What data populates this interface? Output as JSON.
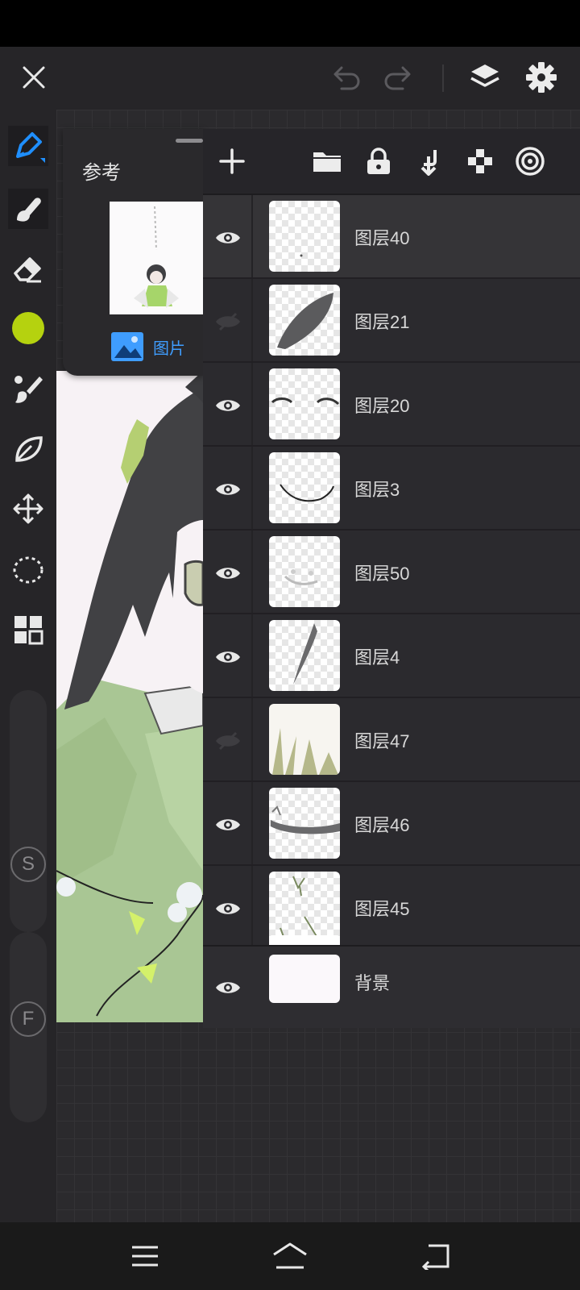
{
  "reference_panel": {
    "title": "参考",
    "image_button_label": "图片"
  },
  "layers": [
    {
      "name": "图层40",
      "visible": true,
      "selected": true
    },
    {
      "name": "图层21",
      "visible": false,
      "selected": false
    },
    {
      "name": "图层20",
      "visible": true,
      "selected": false
    },
    {
      "name": "图层3",
      "visible": true,
      "selected": false
    },
    {
      "name": "图层50",
      "visible": true,
      "selected": false
    },
    {
      "name": "图层4",
      "visible": true,
      "selected": false
    },
    {
      "name": "图层47",
      "visible": false,
      "selected": false
    },
    {
      "name": "图层46",
      "visible": true,
      "selected": false
    },
    {
      "name": "图层45",
      "visible": true,
      "selected": false
    }
  ],
  "background_layer": {
    "name": "背景",
    "visible": true
  },
  "side_buttons": {
    "s_label": "S",
    "f_label": "F"
  },
  "colors": {
    "current_color": "#b5d20f",
    "active_tool": "#1f8fff",
    "accent_blue": "#3f9dff"
  },
  "icons": {
    "top": [
      "close-icon",
      "undo-icon",
      "redo-icon",
      "layers-icon",
      "gear-icon"
    ],
    "tools": [
      "pen-icon",
      "smudge-icon",
      "eraser-icon",
      "color-icon",
      "brush-icon",
      "leaf-icon",
      "move-icon",
      "lasso-icon",
      "grid-icon"
    ],
    "layer_toolbar": [
      "plus-icon",
      "folder-icon",
      "lock-icon",
      "merge-down-icon",
      "checker-icon",
      "target-icon"
    ]
  }
}
